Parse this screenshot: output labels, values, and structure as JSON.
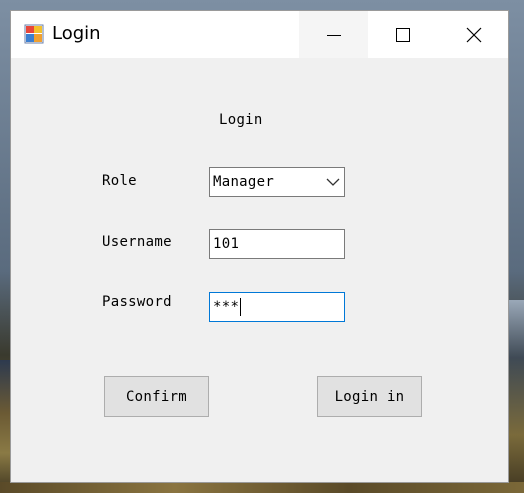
{
  "window": {
    "title": "Login",
    "controls": {
      "minimize_icon": "minimize-icon",
      "maximize_icon": "maximize-icon",
      "close_icon": "close-icon"
    }
  },
  "form": {
    "heading": "Login",
    "role": {
      "label": "Role",
      "selected": "Manager"
    },
    "username": {
      "label": "Username",
      "value": "101"
    },
    "password": {
      "label": "Password",
      "value": "***"
    },
    "buttons": {
      "confirm": "Confirm",
      "login": "Login in"
    }
  },
  "colors": {
    "window_bg": "#f0f0f0",
    "titlebar_bg": "#ffffff",
    "focus_border": "#0078d7",
    "button_bg": "#e1e1e1"
  }
}
